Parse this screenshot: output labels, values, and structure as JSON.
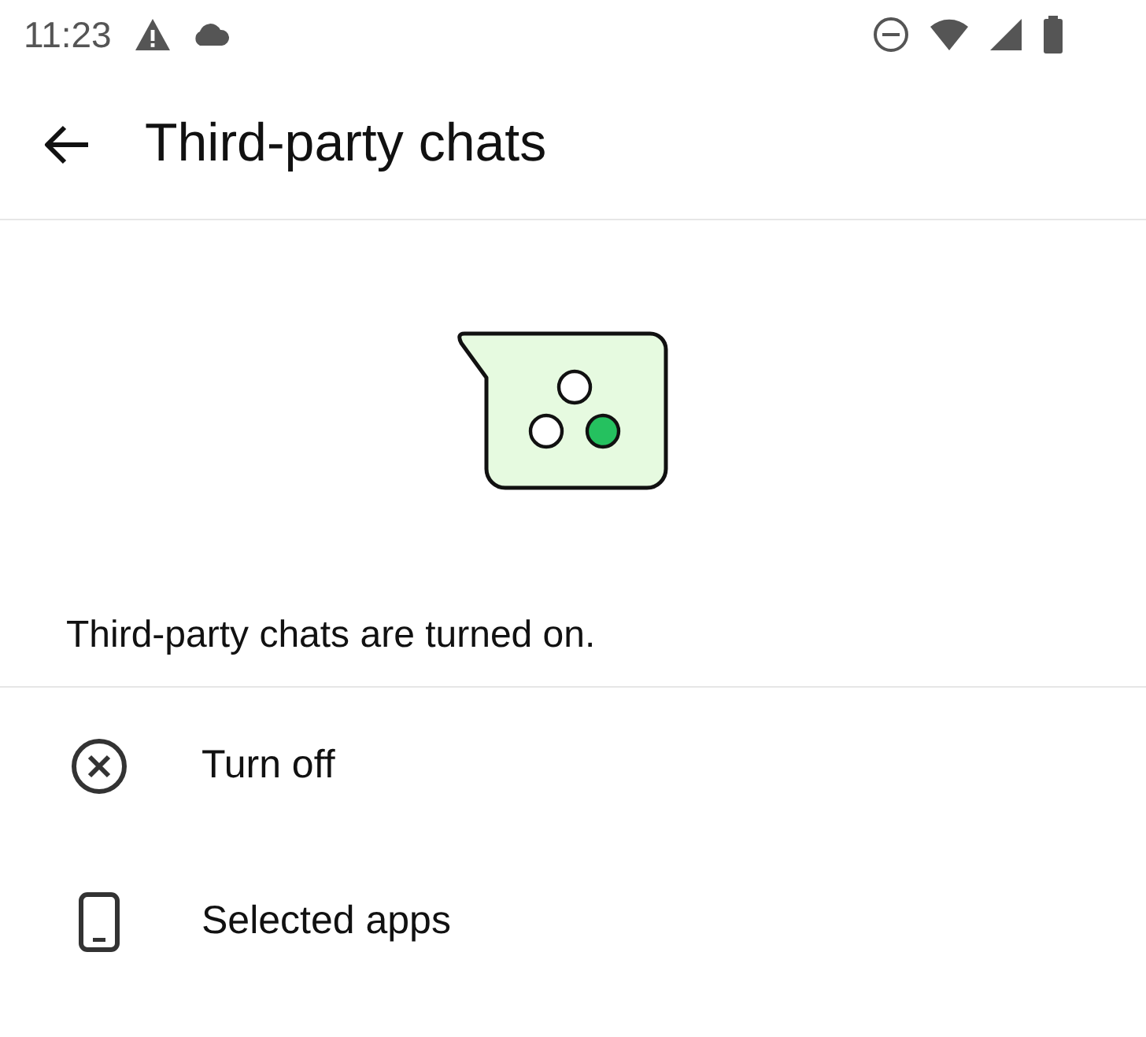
{
  "status_bar": {
    "time": "11:23"
  },
  "app_bar": {
    "title": "Third-party chats"
  },
  "status_message": "Third-party chats are turned on.",
  "options": [
    {
      "kind": "turn-off",
      "label": "Turn off"
    },
    {
      "kind": "apps",
      "label": "Selected apps"
    }
  ]
}
